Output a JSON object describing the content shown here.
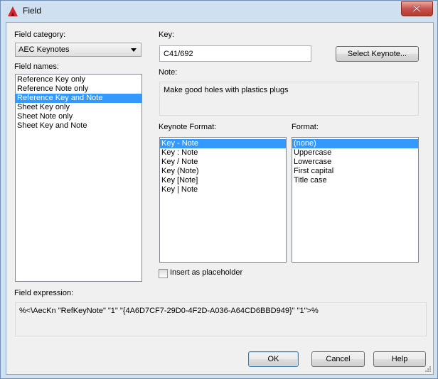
{
  "window": {
    "title": "Field"
  },
  "field_category": {
    "label": "Field category:",
    "value": "AEC Keynotes"
  },
  "field_names": {
    "label": "Field names:",
    "items": [
      "Reference Key only",
      "Reference Note only",
      "Reference Key and Note",
      "Sheet Key only",
      "Sheet Note only",
      "Sheet Key and Note"
    ],
    "selected": "Reference Key and Note"
  },
  "key": {
    "label": "Key:",
    "value": "C41/692"
  },
  "select_keynote_button": "Select Keynote...",
  "note": {
    "label": "Note:",
    "value": "Make good holes with plastics plugs"
  },
  "keynote_format": {
    "label": "Keynote Format:",
    "items": [
      "Key - Note",
      "Key : Note",
      "Key / Note",
      "Key (Note)",
      "Key [Note]",
      "Key | Note"
    ],
    "selected": "Key - Note"
  },
  "format": {
    "label": "Format:",
    "items": [
      "(none)",
      "Uppercase",
      "Lowercase",
      "First capital",
      "Title case"
    ],
    "selected": "(none)"
  },
  "insert_placeholder": {
    "label": "Insert as placeholder",
    "checked": false
  },
  "field_expression": {
    "label": "Field expression:",
    "value": "%<\\AecKn \"RefKeyNote\" \"1\" \"{4A6D7CF7-29D0-4F2D-A036-A64CD6BBD949}\" \"1\">%"
  },
  "buttons": {
    "ok": "OK",
    "cancel": "Cancel",
    "help": "Help"
  },
  "colors": {
    "selection": "#3399ff",
    "title_bar": "#cfe0f1",
    "close_button": "#c75050"
  }
}
